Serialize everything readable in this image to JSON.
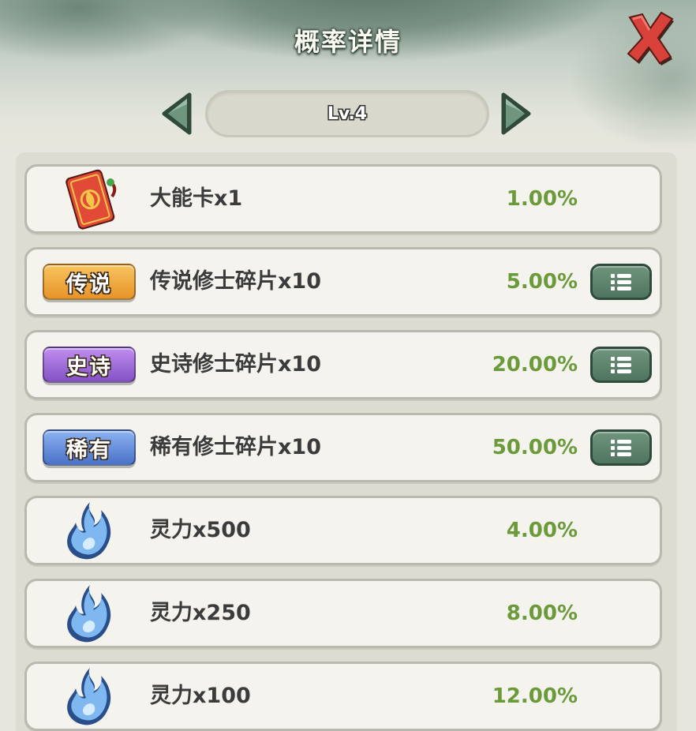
{
  "header": {
    "title": "概率详情"
  },
  "level_selector": {
    "label": "Lv.4"
  },
  "colors": {
    "percent_text": "#6a9a3a",
    "legend_badge": "#f2a53a",
    "epic_badge": "#9c6ad0",
    "rare_badge": "#5f86d6",
    "detail_button": "#5c8069"
  },
  "rows": [
    {
      "icon": "red-card-icon",
      "badge": "",
      "name": "大能卡x1",
      "percent": "1.00%",
      "has_detail": false
    },
    {
      "icon": "legend-badge",
      "badge": "传说",
      "name": "传说修士碎片x10",
      "percent": "5.00%",
      "has_detail": true
    },
    {
      "icon": "epic-badge",
      "badge": "史诗",
      "name": "史诗修士碎片x10",
      "percent": "20.00%",
      "has_detail": true
    },
    {
      "icon": "rare-badge",
      "badge": "稀有",
      "name": "稀有修士碎片x10",
      "percent": "50.00%",
      "has_detail": true
    },
    {
      "icon": "blue-flame-icon",
      "badge": "",
      "name": "灵力x500",
      "percent": "4.00%",
      "has_detail": false
    },
    {
      "icon": "blue-flame-icon",
      "badge": "",
      "name": "灵力x250",
      "percent": "8.00%",
      "has_detail": false
    },
    {
      "icon": "blue-flame-icon",
      "badge": "",
      "name": "灵力x100",
      "percent": "12.00%",
      "has_detail": false
    }
  ]
}
